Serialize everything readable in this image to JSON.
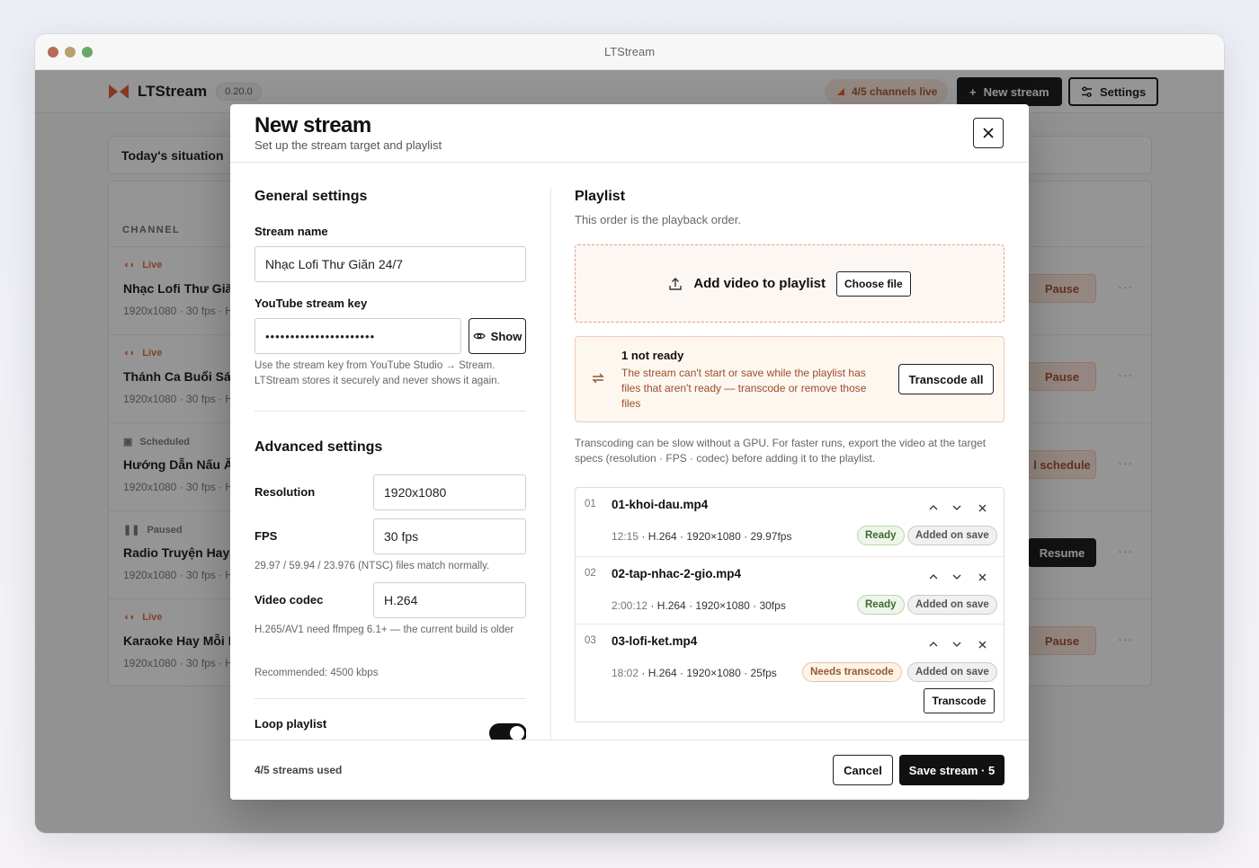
{
  "window": {
    "title": "LTStream"
  },
  "app": {
    "logo_text": "LTStream",
    "version": "0.20.0",
    "live_pill": "4/5 channels live",
    "new_stream_label": "New stream",
    "settings_label": "Settings",
    "panel_title": "Today's situation",
    "col_header": "CHANNEL",
    "rows": [
      {
        "status": "Live",
        "name": "Nhạc Lofi Thư Giãn",
        "meta": "1920x1080 · 30 fps · H",
        "action": "Pause"
      },
      {
        "status": "Live",
        "name": "Thánh Ca Buổi Sán",
        "meta": "1920x1080 · 30 fps · H",
        "action": "Pause"
      },
      {
        "status": "Scheduled",
        "name": "Hướng Dẫn Nấu Ăn",
        "meta": "1920x1080 · 30 fps · H",
        "action": "l schedule"
      },
      {
        "status": "Paused",
        "name": "Radio Truyện Hay I",
        "meta": "1920x1080 · 30 fps · H",
        "action": "Resume"
      },
      {
        "status": "Live",
        "name": "Karaoke Hay Mỗi N",
        "meta": "1920x1080 · 30 fps · H",
        "action": "Pause"
      }
    ]
  },
  "modal": {
    "title": "New stream",
    "subtitle": "Set up the stream target and playlist",
    "general": {
      "title": "General settings",
      "stream_name_label": "Stream name",
      "stream_name_value": "Nhạc Lofi Thư Giãn 24/7",
      "key_label": "YouTube stream key",
      "key_value": "••••••••••••••••••••••",
      "show_label": "Show",
      "key_help": "Use the stream key from YouTube Studio → Stream. LTStream stores it securely and never shows it again."
    },
    "advanced": {
      "title": "Advanced settings",
      "resolution_label": "Resolution",
      "resolution_value": "1920x1080",
      "fps_label": "FPS",
      "fps_value": "30 fps",
      "fps_help": "29.97 / 59.94 / 23.976 (NTSC) files match normally.",
      "codec_label": "Video codec",
      "codec_value": "H.264",
      "codec_help": "H.265/AV1 need ffmpeg 6.1+ — the current build is older",
      "recommended": "Recommended: 4500 kbps",
      "loop_label": "Loop playlist",
      "loop_on": true
    },
    "playlist": {
      "title": "Playlist",
      "subtitle": "This order is the playback order.",
      "add_label": "Add video to playlist",
      "choose_label": "Choose file",
      "warn_title": "1 not ready",
      "warn_text": "The stream can't start or save while the playlist has files that aren't ready — transcode or remove those files",
      "transcode_all_label": "Transcode all",
      "note": "Transcoding can be slow without a GPU. For faster runs, export the video at the target specs (resolution · FPS · codec) before adding it to the playlist.",
      "items": [
        {
          "num": "01",
          "name": "01-khoi-dau.mp4",
          "duration": "12:15",
          "specs": " · H.264 · 1920×1080 · 29.97fps",
          "status": "Ready",
          "tag": "Added on save"
        },
        {
          "num": "02",
          "name": "02-tap-nhac-2-gio.mp4",
          "duration": "2:00:12",
          "specs": " · H.264 · 1920×1080 · 30fps",
          "status": "Ready",
          "tag": "Added on save"
        },
        {
          "num": "03",
          "name": "03-lofi-ket.mp4",
          "duration": "18:02",
          "specs": " · H.264 · 1920×1080 · 25fps",
          "status": "Needs transcode",
          "tag": "Added on save",
          "action": "Transcode"
        }
      ]
    },
    "footer": {
      "usage": "4/5  streams used",
      "cancel_label": "Cancel",
      "save_label": "Save stream · 5"
    }
  }
}
